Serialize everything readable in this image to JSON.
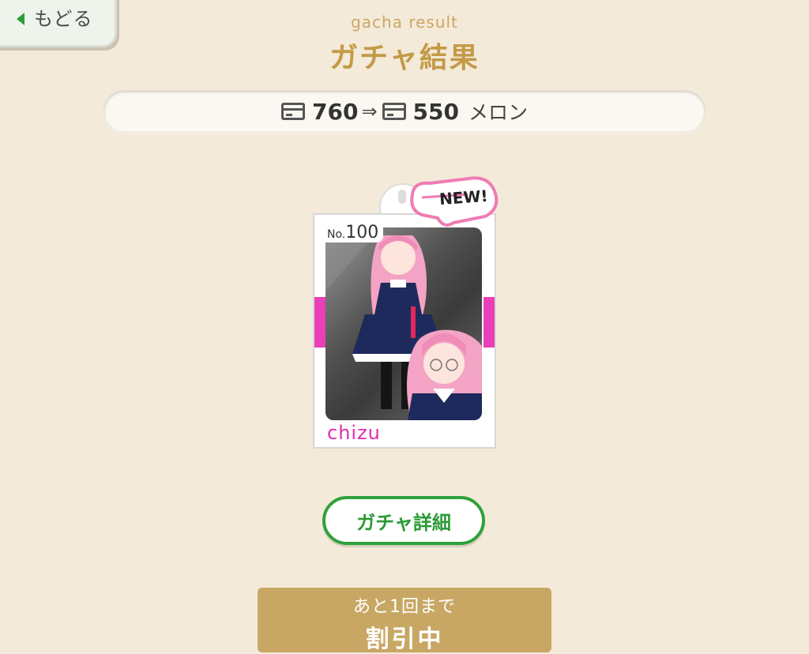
{
  "nav": {
    "back_label": "もどる"
  },
  "header": {
    "subtitle": "gacha result",
    "title": "ガチャ結果"
  },
  "balance": {
    "before": "760",
    "arrow": "⇒",
    "after": "550",
    "unit": "メロン"
  },
  "card": {
    "no_prefix": "No.",
    "number": "100",
    "name": "chizu",
    "badge": "NEW!"
  },
  "buttons": {
    "detail_label": "ガチャ詳細",
    "sale_line1": "あと1回まで",
    "sale_line2": "割引中"
  },
  "colors": {
    "accent_gold": "#c49a47",
    "accent_green": "#2fa23b",
    "accent_pink": "#e12dae",
    "background": "#f3ead9"
  },
  "icons": {
    "back": "triangle-left-icon",
    "currency": "card-icon",
    "new": "pointing-hand-badge-icon"
  }
}
